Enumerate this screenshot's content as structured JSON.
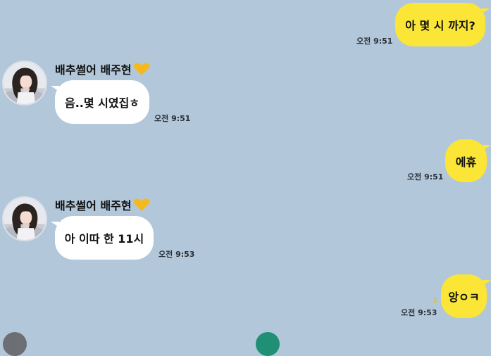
{
  "colors": {
    "background": "#b2c7d9",
    "outgoing_bubble": "#fbe537",
    "incoming_bubble": "#ffffff",
    "unread": "#e6c21b"
  },
  "messages": [
    {
      "direction": "out",
      "text": "아 몇 시 까지?",
      "time": "오전 9:51"
    },
    {
      "direction": "in",
      "sender": "배추썰어 배주현",
      "text": "음..몇 시였집ㅎ",
      "time": "오전 9:51"
    },
    {
      "direction": "out",
      "text": "에휴",
      "time": "오전 9:51"
    },
    {
      "direction": "in",
      "sender": "배추썰어 배주현",
      "text": "아 이따 한 11시",
      "time": "오전 9:53"
    },
    {
      "direction": "out",
      "text": "앙ㅇㅋ",
      "time": "오전 9:53",
      "unread": "1"
    }
  ],
  "icons": {
    "heart": "yellow-heart-icon",
    "avatar": "profile-avatar"
  }
}
